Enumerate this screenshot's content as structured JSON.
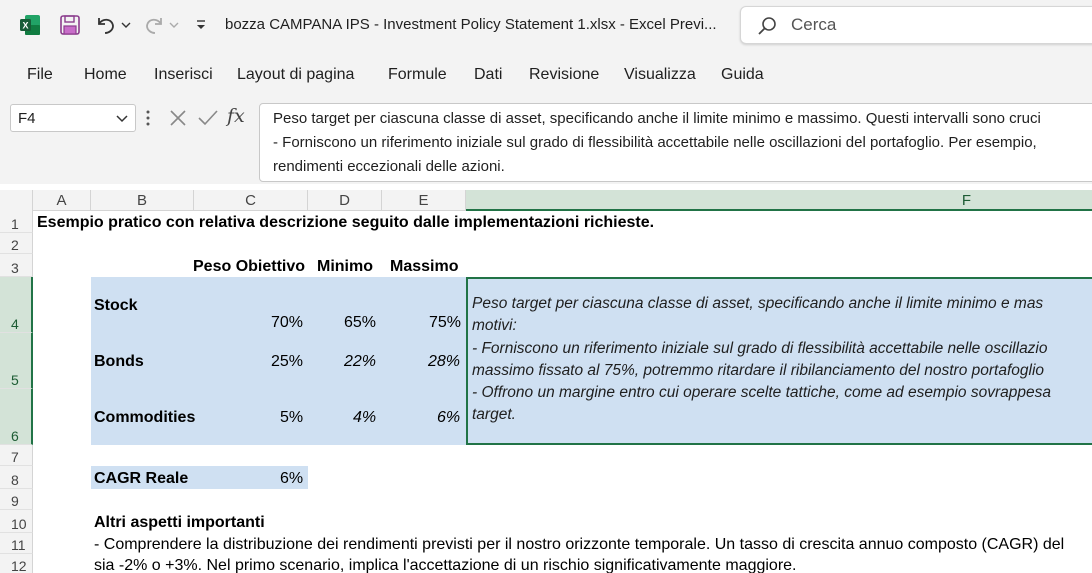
{
  "titlebar": {
    "document_title": "bozza CAMPANA IPS - Investment Policy Statement 1.xlsx  -  Excel Previ...",
    "search_placeholder": "Cerca"
  },
  "icons": {
    "app": "excel-logo-icon",
    "save": "save-icon",
    "undo": "undo-icon",
    "redo": "redo-icon",
    "qat": "customize-qat-icon",
    "search": "search-icon",
    "cancel": "cancel-icon",
    "enter": "enter-check-icon",
    "fx": "fx-icon"
  },
  "menu": [
    "File",
    "Home",
    "Inserisci",
    "Layout di pagina",
    "Formule",
    "Dati",
    "Revisione",
    "Visualizza",
    "Guida"
  ],
  "formula_bar": {
    "name_box": "F4",
    "fx_label": "fx",
    "lines": [
      "Peso target per ciascuna classe di asset, specificando anche il limite minimo e massimo. Questi intervalli sono cruci",
      "- Forniscono un riferimento iniziale sul grado di flessibilità accettabile nelle oscillazioni del portafoglio. Per esempio,",
      "rendimenti eccezionali delle azioni."
    ]
  },
  "columns": [
    "A",
    "B",
    "C",
    "D",
    "E",
    "F"
  ],
  "rows": [
    "1",
    "2",
    "3",
    "4",
    "5",
    "6",
    "7",
    "8",
    "9",
    "10",
    "11",
    "12"
  ],
  "sheet": {
    "r1_title": "Esempio pratico con relativa descrizione seguito dalle implementazioni richieste.",
    "headers": {
      "peso": "Peso Obiettivo",
      "minimo": "Minimo",
      "massimo": "Massimo"
    },
    "assets": [
      {
        "name": "Stock",
        "peso": "70%",
        "minimo": "65%",
        "massimo": "75%"
      },
      {
        "name": "Bonds",
        "peso": "25%",
        "minimo": "22%",
        "massimo": "28%"
      },
      {
        "name": "Commodities",
        "peso": "5%",
        "minimo": "4%",
        "massimo": "6%"
      }
    ],
    "f_block_lines": [
      "Peso target per ciascuna classe di asset, specificando anche il limite minimo e mas",
      "motivi:",
      "- Forniscono un riferimento iniziale sul grado di flessibilità accettabile nelle oscillazio",
      "massimo fissato al 75%, potremmo ritardare il ribilanciamento del nostro portafoglio",
      "- Offrono un margine entro cui operare scelte tattiche, come ad esempio sovrappesa",
      "target."
    ],
    "cagr_label": "CAGR Reale",
    "cagr_value": "6%",
    "r10_heading": "Altri aspetti importanti",
    "r11_text": "- Comprendere la distribuzione dei rendimenti previsti per il nostro orizzonte temporale. Un tasso di crescita annuo composto (CAGR) del",
    "r12_text": "sia -2% o +3%. Nel primo scenario, implica l'accettazione di un rischio significativamente maggiore."
  },
  "colors": {
    "accent": "#217346",
    "fill_blue": "#cfe0f2",
    "chrome_bg": "#f3f3f3"
  }
}
